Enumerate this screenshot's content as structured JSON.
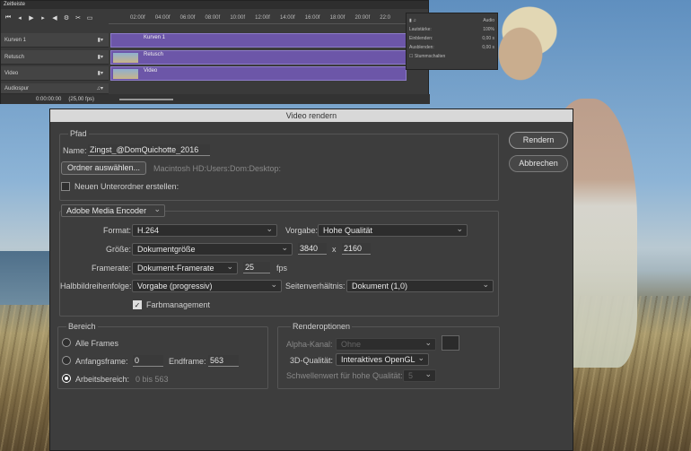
{
  "timeline": {
    "title": "Zeitleiste",
    "ticks": [
      "02:00f",
      "04:00f",
      "06:00f",
      "08:00f",
      "10:00f",
      "12:00f",
      "14:00f",
      "16:00f",
      "18:00f",
      "20:00f",
      "22:0"
    ],
    "tracks": [
      {
        "name": "Kurven 1",
        "clip": "Kurven 1"
      },
      {
        "name": "Retusch",
        "clip": "Retusch"
      },
      {
        "name": "Video",
        "clip": "Video"
      }
    ],
    "audio_track": "Audiospur",
    "timecode": "0:00:00:00",
    "fps": "(25,00 fps)"
  },
  "audio_panel": {
    "title": "Audio",
    "rows": [
      {
        "label": "Lautstärke:",
        "value": "100%"
      },
      {
        "label": "Einblenden:",
        "value": "0,00 s"
      },
      {
        "label": "Ausblenden:",
        "value": "0,00 s"
      }
    ],
    "mute": "Stummschalten"
  },
  "dialog": {
    "title": "Video rendern",
    "path": {
      "section": "Pfad",
      "name_label": "Name:",
      "name_value": "Zingst_@DomQuichotte_2016",
      "folder_button": "Ordner auswählen...",
      "folder_path": "Macintosh HD:Users:Dom:Desktop:",
      "subfolder_label": "Neuen Unterordner erstellen:"
    },
    "encoder": "Adobe Media Encoder",
    "format_label": "Format:",
    "format": "H.264",
    "preset_label": "Vorgabe:",
    "preset": "Hohe Qualität",
    "size_label": "Größe:",
    "size": "Dokumentgröße",
    "width": "3840",
    "x": "x",
    "height": "2160",
    "framerate_label": "Framerate:",
    "framerate": "Dokument-Framerate",
    "fps_value": "25",
    "fps_unit": "fps",
    "field_order_label": "Halbbildreihenfolge:",
    "field_order": "Vorgabe (progressiv)",
    "aspect_label": "Seitenverhältnis:",
    "aspect": "Dokument (1,0)",
    "color_mgmt": "Farbmanagement",
    "range": {
      "section": "Bereich",
      "all_frames": "Alle Frames",
      "start_label": "Anfangsframe:",
      "start_value": "0",
      "end_label": "Endframe:",
      "end_value": "563",
      "work_area": "Arbeitsbereich:",
      "work_area_value": "0 bis 563"
    },
    "render_options": {
      "section": "Renderoptionen",
      "alpha_label": "Alpha-Kanal:",
      "alpha": "Ohne",
      "quality3d_label": "3D-Qualität:",
      "quality3d": "Interaktives OpenGL",
      "threshold_label": "Schwellenwert für hohe Qualität:",
      "threshold": "5"
    },
    "render_button": "Rendern",
    "cancel_button": "Abbrechen"
  }
}
